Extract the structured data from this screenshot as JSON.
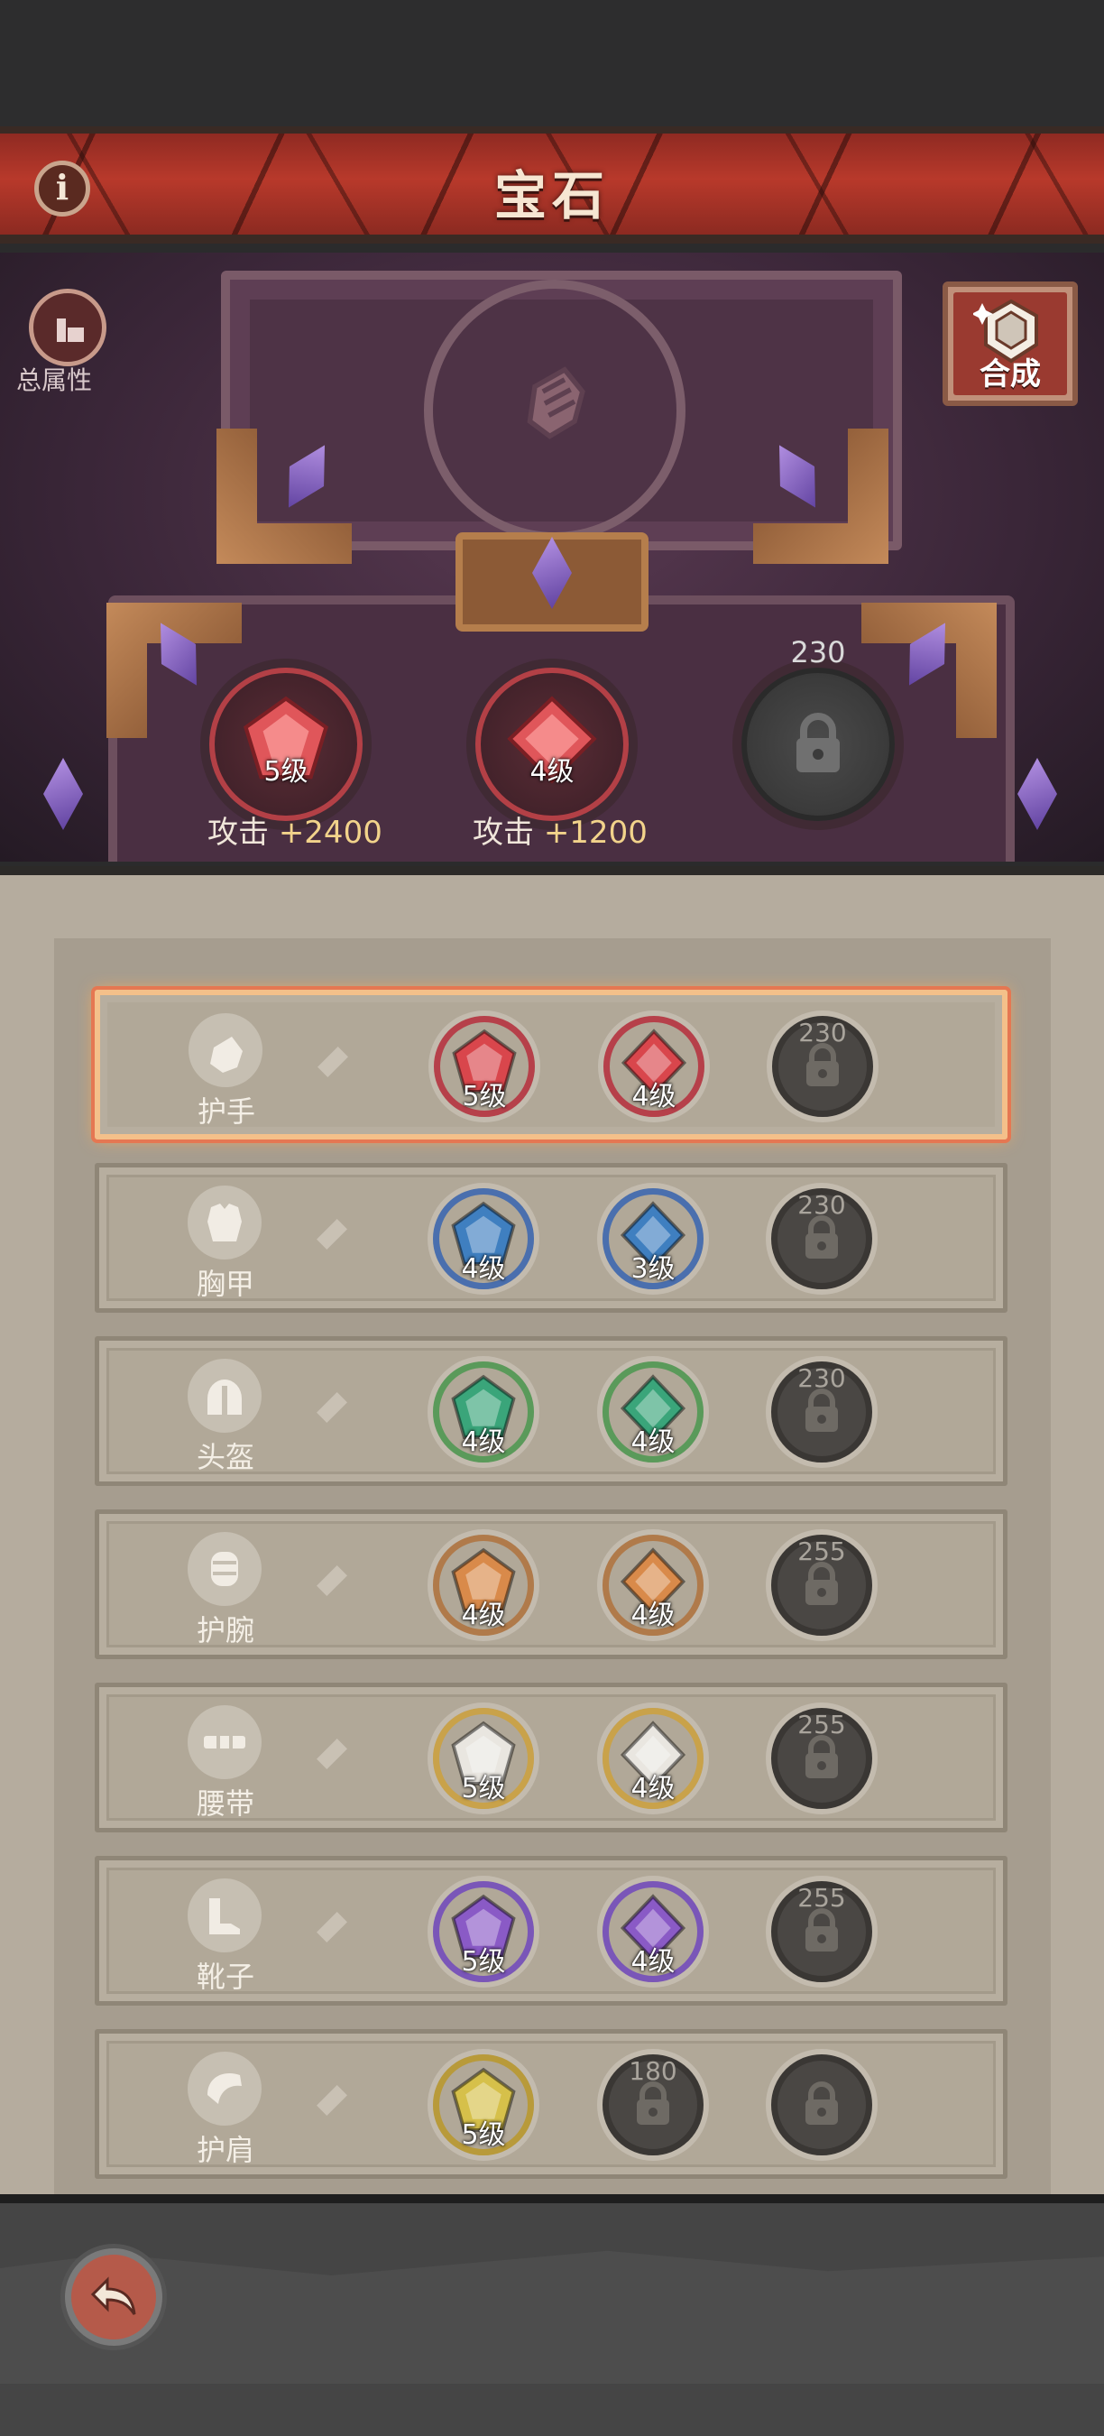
{
  "header": {
    "title": "宝石",
    "info_icon": "info-icon",
    "info_glyph": "i"
  },
  "hero": {
    "equipped_icon": "gauntlet-icon",
    "total_attr_label": "总属性",
    "synth_label": "合成",
    "slots": [
      {
        "level": "5级",
        "gem_color": "#d94a4f",
        "locked": false
      },
      {
        "level": "4级",
        "gem_color": "#d94a4f",
        "locked": false
      },
      {
        "level": "",
        "locked": true,
        "unlock_value": "230"
      }
    ],
    "bonuses": [
      {
        "label": "攻击",
        "value": "+2400"
      },
      {
        "label": "攻击",
        "value": "+1200"
      }
    ]
  },
  "equipment": [
    {
      "name": "护手",
      "icon": "gauntlet-icon",
      "selected": true,
      "slots": [
        {
          "level": "5级",
          "color": "#d9464c",
          "ring": "#b6404a"
        },
        {
          "level": "4级",
          "color": "#d9464c",
          "ring": "#b6404a"
        },
        {
          "locked": true,
          "unlock": "230"
        }
      ]
    },
    {
      "name": "胸甲",
      "icon": "chestplate-icon",
      "selected": false,
      "slots": [
        {
          "level": "4级",
          "color": "#3f7fc0",
          "ring": "#4a6fae"
        },
        {
          "level": "3级",
          "color": "#3f7fc0",
          "ring": "#4a6fae"
        },
        {
          "locked": true,
          "unlock": "230"
        }
      ]
    },
    {
      "name": "头盔",
      "icon": "helmet-icon",
      "selected": false,
      "slots": [
        {
          "level": "4级",
          "color": "#3aa57a",
          "ring": "#5a9a5a"
        },
        {
          "level": "4级",
          "color": "#3aa57a",
          "ring": "#5a9a5a"
        },
        {
          "locked": true,
          "unlock": "230"
        }
      ]
    },
    {
      "name": "护腕",
      "icon": "bracer-icon",
      "selected": false,
      "slots": [
        {
          "level": "4级",
          "color": "#d98a4a",
          "ring": "#b07a4a"
        },
        {
          "level": "4级",
          "color": "#d98a4a",
          "ring": "#b07a4a"
        },
        {
          "locked": true,
          "unlock": "255"
        }
      ]
    },
    {
      "name": "腰带",
      "icon": "belt-icon",
      "selected": false,
      "slots": [
        {
          "level": "5级",
          "color": "#e9e6e0",
          "ring": "#c9a24a"
        },
        {
          "level": "4级",
          "color": "#e9e6e0",
          "ring": "#c9a24a"
        },
        {
          "locked": true,
          "unlock": "255"
        }
      ]
    },
    {
      "name": "靴子",
      "icon": "boots-icon",
      "selected": false,
      "slots": [
        {
          "level": "5级",
          "color": "#8a5ac6",
          "ring": "#7a56b8"
        },
        {
          "level": "4级",
          "color": "#8a5ac6",
          "ring": "#7a56b8"
        },
        {
          "locked": true,
          "unlock": "255"
        }
      ]
    },
    {
      "name": "护肩",
      "icon": "pauldron-icon",
      "selected": false,
      "slots": [
        {
          "level": "5级",
          "color": "#d6c04a",
          "ring": "#b89a3a"
        },
        {
          "locked": true,
          "unlock": "180"
        },
        {
          "locked": true,
          "unlock": ""
        }
      ]
    }
  ],
  "footer": {
    "back_icon": "back-arrow-icon"
  }
}
